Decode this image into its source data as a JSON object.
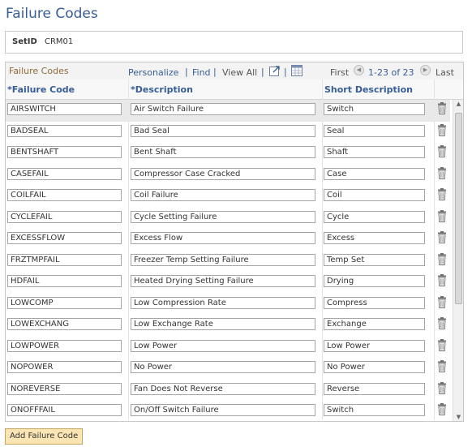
{
  "page": {
    "title": "Failure Codes"
  },
  "setid": {
    "label": "SetID",
    "value": "CRM01"
  },
  "grid": {
    "title": "Failure Codes",
    "toolbar": {
      "personalize": "Personalize",
      "sep": "|",
      "find": "Find",
      "view_all": "View All",
      "first": "First",
      "range": "1-23 of 23",
      "last": "Last"
    },
    "columns": {
      "code": "*Failure Code",
      "description": "*Description",
      "short": "Short Description"
    },
    "rows": [
      {
        "code": "AIRSWITCH",
        "description": "Air Switch Failure",
        "short": "Switch"
      },
      {
        "code": "BADSEAL",
        "description": "Bad Seal",
        "short": "Seal"
      },
      {
        "code": "BENTSHAFT",
        "description": "Bent Shaft",
        "short": "Shaft"
      },
      {
        "code": "CASEFAIL",
        "description": "Compressor Case Cracked",
        "short": "Case"
      },
      {
        "code": "COILFAIL",
        "description": "Coil Failure",
        "short": "Coil"
      },
      {
        "code": "CYCLEFAIL",
        "description": "Cycle Setting Failure",
        "short": "Cycle"
      },
      {
        "code": "EXCESSFLOW",
        "description": "Excess Flow",
        "short": "Excess"
      },
      {
        "code": "FRZTMPFAIL",
        "description": "Freezer Temp Setting Failure",
        "short": "Temp Set"
      },
      {
        "code": "HDFAIL",
        "description": "Heated Drying Setting Failure",
        "short": "Drying"
      },
      {
        "code": "LOWCOMP",
        "description": "Low Compression Rate",
        "short": "Compress"
      },
      {
        "code": "LOWEXCHANG",
        "description": "Low Exchange Rate",
        "short": "Exchange"
      },
      {
        "code": "LOWPOWER",
        "description": "Low Power",
        "short": "Low Power"
      },
      {
        "code": "NOPOWER",
        "description": "No Power",
        "short": "No Power"
      },
      {
        "code": "NOREVERSE",
        "description": "Fan Does Not Reverse",
        "short": "Reverse"
      },
      {
        "code": "ONOFFFAIL",
        "description": "On/Off Switch Failure",
        "short": "Switch"
      }
    ]
  },
  "add_button": {
    "label": "Add Failure Code"
  },
  "icons": {
    "row_delete": "trash-icon",
    "zoom": "zoom-icon",
    "download": "grid-download-icon",
    "prev": "prev-arrow-icon",
    "next": "next-arrow-icon"
  },
  "colors": {
    "link": "#375d95",
    "grid_title": "#8e6a3a",
    "button_bg": "#fbe5b4"
  }
}
